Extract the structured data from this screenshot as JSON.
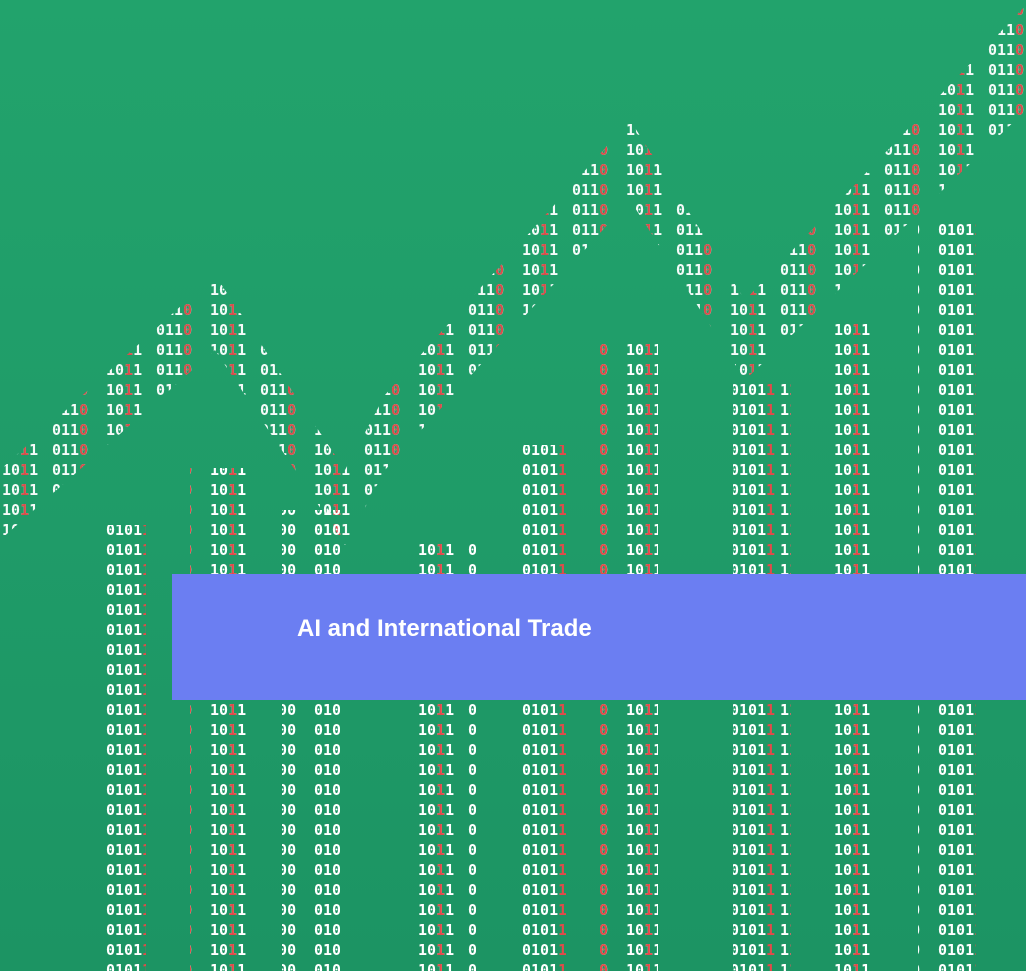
{
  "banner": {
    "title": "AI and International Trade"
  },
  "colors": {
    "background": "#1f9e6a",
    "digit": "#ffffff",
    "digit_highlight": "#e24a4a",
    "banner": "#6b7ef2",
    "banner_text": "#ffffff"
  }
}
